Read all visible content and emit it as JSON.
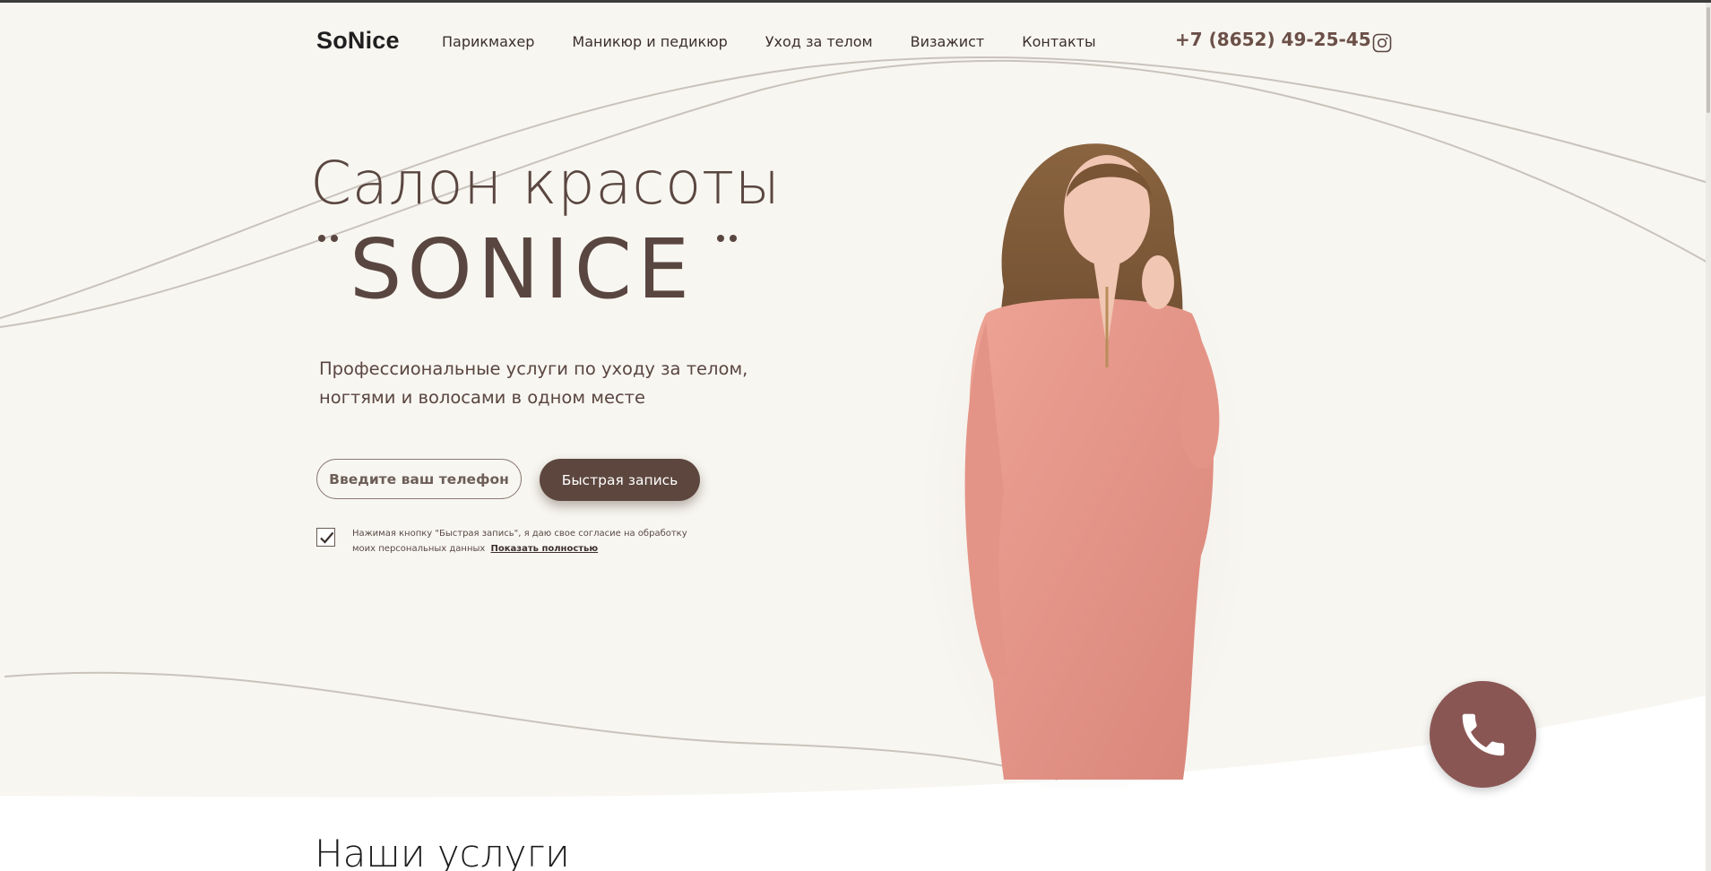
{
  "header": {
    "logo": "SoNice",
    "nav": [
      "Парикмахер",
      "Маникюр и педикюр",
      "Уход за телом",
      "Визажист",
      "Контакты"
    ],
    "phone": "+7 (8652) 49-25-45",
    "social_icon": "instagram-icon"
  },
  "hero": {
    "title_line1": "Салон красоты",
    "title_line2": "SONICE",
    "subtitle_line1": "Профессиональные услуги по уходу за телом,",
    "subtitle_line2": "ногтями и волосами в одном месте",
    "phone_placeholder": "Введите ваш телефон",
    "cta_label": "Быстрая запись",
    "consent_text": "Нажимая кнопку \"Быстрая запись\", я даю свое согласие на обработку моих персональных данных",
    "consent_link": "Показать полностью",
    "consent_checked": true
  },
  "services": {
    "title": "Наши услуги"
  },
  "floating": {
    "call_icon": "phone-icon"
  },
  "colors": {
    "background": "#f8f6f1",
    "accent": "#5c463e",
    "call_button": "#8a5654",
    "dress": "#e6988a"
  }
}
